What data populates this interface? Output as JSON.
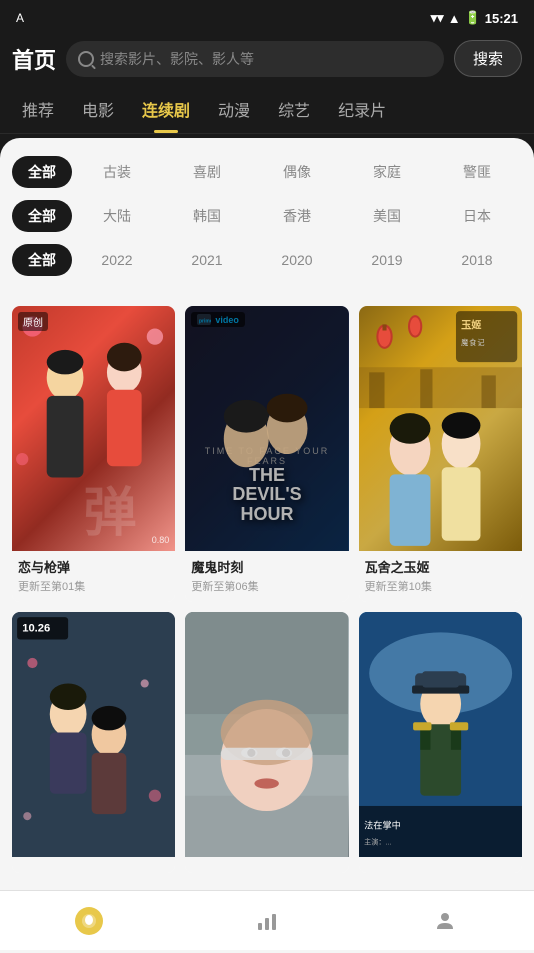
{
  "statusBar": {
    "appIcon": "A",
    "time": "15:21",
    "batteryIcon": "🔋"
  },
  "header": {
    "title": "首页",
    "searchPlaceholder": "搜索影片、影院、影人等",
    "searchButton": "搜索"
  },
  "navTabs": [
    {
      "id": "recommend",
      "label": "推荐"
    },
    {
      "id": "movies",
      "label": "电影"
    },
    {
      "id": "series",
      "label": "连续剧",
      "active": true
    },
    {
      "id": "anime",
      "label": "动漫"
    },
    {
      "id": "variety",
      "label": "综艺"
    },
    {
      "id": "documentary",
      "label": "纪录片"
    }
  ],
  "filters": [
    {
      "id": "genre",
      "allLabel": "全部",
      "tags": [
        "古装",
        "喜剧",
        "偶像",
        "家庭",
        "警匪"
      ]
    },
    {
      "id": "region",
      "allLabel": "全部",
      "tags": [
        "大陆",
        "韩国",
        "香港",
        "美国",
        "日本"
      ]
    },
    {
      "id": "year",
      "allLabel": "全部",
      "tags": [
        "2022",
        "2021",
        "2020",
        "2019",
        "2018"
      ]
    }
  ],
  "cards": [
    {
      "id": "card1",
      "title": "恋与枪弹",
      "subtitle": "更新至第01集",
      "posterStyle": "1",
      "posterLabel": "原创",
      "posterDate": "0.80",
      "posterText": "弹"
    },
    {
      "id": "card2",
      "title": "魔鬼时刻",
      "subtitle": "更新至第06集",
      "posterStyle": "2",
      "posterLabel": "prime video",
      "posterText": "THE DEVIL'S HOUR"
    },
    {
      "id": "card3",
      "title": "瓦舍之玉姬",
      "subtitle": "更新至第10集",
      "posterStyle": "3",
      "posterLabel": "",
      "posterText": "玉姬"
    },
    {
      "id": "card4",
      "title": "",
      "subtitle": "",
      "posterStyle": "4",
      "posterLabel": "10.26",
      "posterText": ""
    },
    {
      "id": "card5",
      "title": "",
      "subtitle": "",
      "posterStyle": "5",
      "posterLabel": "",
      "posterText": ""
    },
    {
      "id": "card6",
      "title": "",
      "subtitle": "",
      "posterStyle": "6",
      "posterLabel": "",
      "posterText": ""
    }
  ],
  "bottomNav": [
    {
      "id": "home",
      "icon": "home",
      "label": "",
      "active": true
    },
    {
      "id": "chart",
      "icon": "chart",
      "label": "",
      "active": false
    },
    {
      "id": "profile",
      "icon": "profile",
      "label": "",
      "active": false
    }
  ]
}
